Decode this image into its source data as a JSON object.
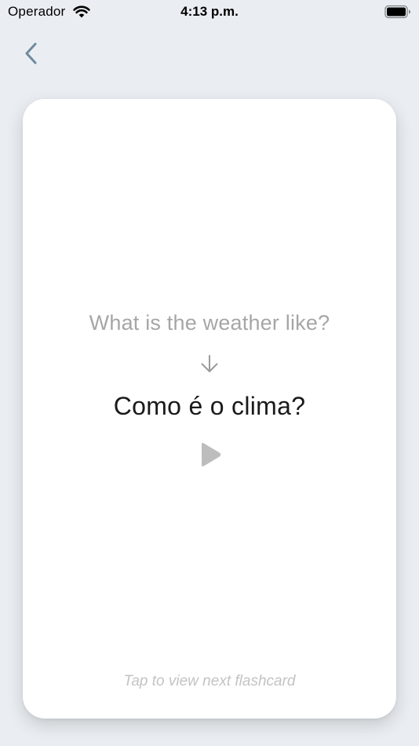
{
  "status_bar": {
    "carrier": "Operador",
    "time": "4:13 p.m.",
    "icons": [
      "wifi-icon",
      "battery-icon"
    ]
  },
  "navigation": {
    "back_icon": "chevron-left-icon"
  },
  "flashcard": {
    "prompt": "What is the weather like?",
    "arrow_icon": "arrow-down-icon",
    "answer": "Como é o clima?",
    "play_icon": "play-icon",
    "hint": "Tap to view next flashcard"
  },
  "colors": {
    "background": "#eaeef2",
    "card": "#ffffff",
    "accent": "#6e8aa0",
    "muted_text": "#a6a6a6",
    "primary_text": "#1a1a1a"
  }
}
